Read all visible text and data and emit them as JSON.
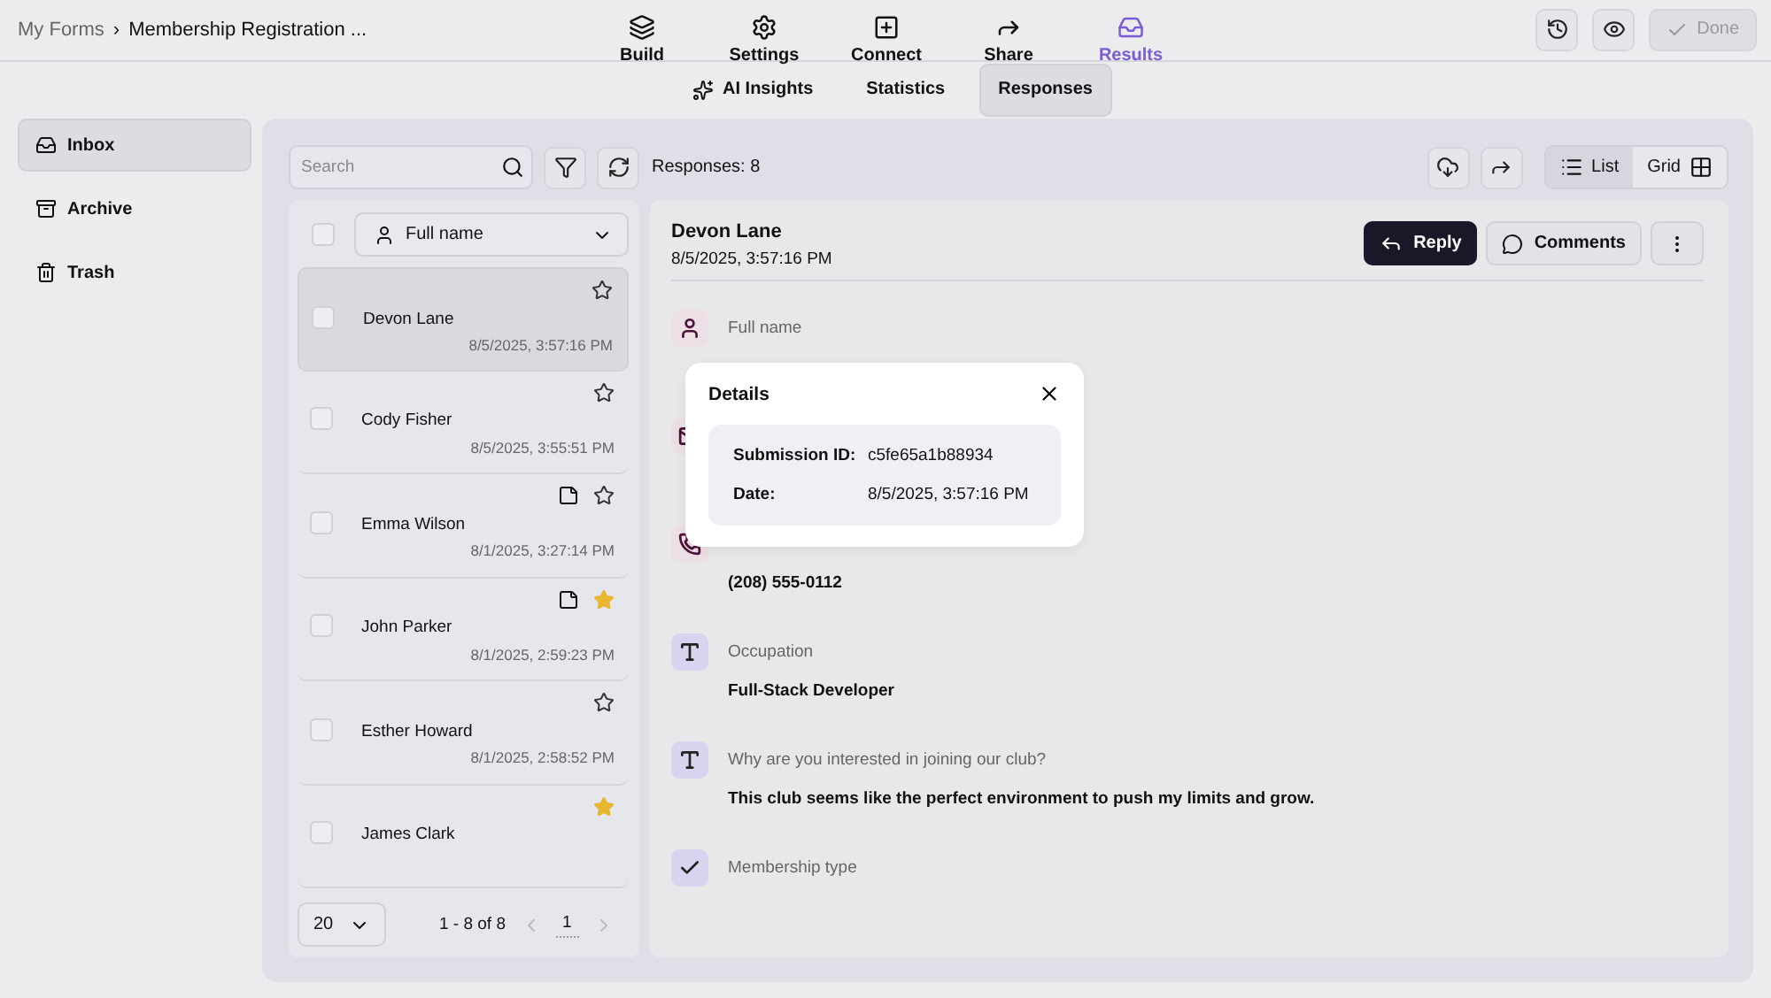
{
  "breadcrumb": {
    "parent": "My Forms",
    "separator": "›",
    "current": "Membership Registration ..."
  },
  "nav_tabs": [
    {
      "label": "Build",
      "selected": false
    },
    {
      "label": "Settings",
      "selected": false
    },
    {
      "label": "Connect",
      "selected": false
    },
    {
      "label": "Share",
      "selected": false
    },
    {
      "label": "Results",
      "selected": true
    }
  ],
  "header_actions": {
    "done": "Done"
  },
  "sub_tabs": [
    {
      "label": "AI Insights",
      "selected": false
    },
    {
      "label": "Statistics",
      "selected": false
    },
    {
      "label": "Responses",
      "selected": true
    }
  ],
  "sidebar": {
    "items": [
      {
        "label": "Inbox",
        "selected": true
      },
      {
        "label": "Archive",
        "selected": false
      },
      {
        "label": "Trash",
        "selected": false
      }
    ]
  },
  "toolbar": {
    "search_placeholder": "Search",
    "count": "Responses: 8",
    "view_toggle": [
      {
        "label": "List",
        "selected": true
      },
      {
        "label": "Grid",
        "selected": false
      }
    ]
  },
  "list": {
    "column": "Full name",
    "select_all_checked": false,
    "items": [
      {
        "name": "Devon Lane",
        "date": "8/5/2025, 3:57:16 PM",
        "selected": true,
        "starred": false,
        "has_note": false,
        "checked": false
      },
      {
        "name": "Cody Fisher",
        "date": "8/5/2025, 3:55:51 PM",
        "selected": false,
        "starred": false,
        "has_note": false,
        "checked": false
      },
      {
        "name": "Emma Wilson",
        "date": "8/1/2025, 3:27:14 PM",
        "selected": false,
        "starred": false,
        "has_note": true,
        "checked": false
      },
      {
        "name": "John Parker",
        "date": "8/1/2025, 2:59:23 PM",
        "selected": false,
        "starred": true,
        "has_note": true,
        "checked": false
      },
      {
        "name": "Esther Howard",
        "date": "8/1/2025, 2:58:52 PM",
        "selected": false,
        "starred": false,
        "has_note": false,
        "checked": false
      },
      {
        "name": "James Clark",
        "selected": false,
        "starred": true,
        "has_note": false,
        "checked": false
      }
    ],
    "page_size": "20",
    "range": "1 - 8 of 8",
    "page": "1"
  },
  "detail": {
    "name": "Devon Lane",
    "date": "8/5/2025, 3:57:16 PM",
    "reply": "Reply",
    "comments": "Comments",
    "fields": [
      {
        "kind": "person",
        "label": "Full name"
      },
      {
        "kind": "email"
      },
      {
        "kind": "phone",
        "value": "(208) 555-0112"
      },
      {
        "kind": "text",
        "label": "Occupation",
        "value": "Full-Stack Developer"
      },
      {
        "kind": "text",
        "label": "Why are you interested in joining our club?",
        "value": "This club seems like the perfect environment to push my limits and grow."
      },
      {
        "kind": "choice",
        "label": "Membership type"
      }
    ]
  },
  "details_popup": {
    "title": "Details",
    "rows": [
      {
        "label": "Submission ID:",
        "value": "c5fe65a1b88934"
      },
      {
        "label": "Date:",
        "value": "8/5/2025, 3:57:16 PM"
      }
    ]
  }
}
